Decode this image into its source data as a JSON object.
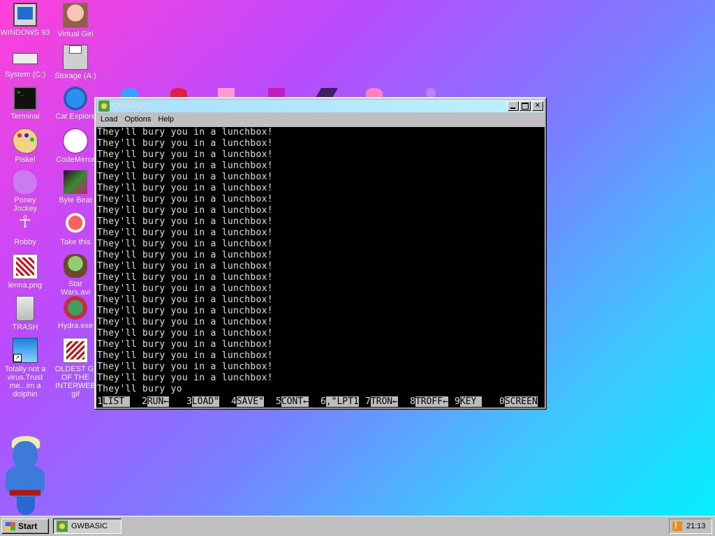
{
  "desktop": {
    "icons": [
      {
        "label": "WINDOWS 93"
      },
      {
        "label": "Virtual Girl"
      },
      {
        "label": "System (C:)"
      },
      {
        "label": "Storage (A:)"
      },
      {
        "label": "Terminal"
      },
      {
        "label": "Cat Explore"
      },
      {
        "label": "Piskel"
      },
      {
        "label": "CodeMirror"
      },
      {
        "label": "Poney\nJockey"
      },
      {
        "label": "Byte Beat"
      },
      {
        "label": "Robby"
      },
      {
        "label": "Take this"
      },
      {
        "label": "lenna.png"
      },
      {
        "label": "Star\nWars.avi"
      },
      {
        "label": "TRASH"
      },
      {
        "label": "Hydra.exe"
      },
      {
        "label": "Totally not a\nvirus.Trust\nme...im a\ndolphin"
      },
      {
        "label": "OLDEST GI\nOF THE\nINTERWEB\ngif"
      }
    ]
  },
  "window": {
    "title": "GWBASIC",
    "menu": [
      "Load",
      "Options",
      "Help"
    ],
    "console": {
      "lines": [
        "They'll bury you in a lunchbox!",
        "They'll bury you in a lunchbox!",
        "They'll bury you in a lunchbox!",
        "They'll bury you in a lunchbox!",
        "They'll bury you in a lunchbox!",
        "They'll bury you in a lunchbox!",
        "They'll bury you in a lunchbox!",
        "They'll bury you in a lunchbox!",
        "They'll bury you in a lunchbox!",
        "They'll bury you in a lunchbox!",
        "They'll bury you in a lunchbox!",
        "They'll bury you in a lunchbox!",
        "They'll bury you in a lunchbox!",
        "They'll bury you in a lunchbox!",
        "They'll bury you in a lunchbox!",
        "They'll bury you in a lunchbox!",
        "They'll bury you in a lunchbox!",
        "They'll bury you in a lunchbox!",
        "They'll bury you in a lunchbox!",
        "They'll bury you in a lunchbox!",
        "They'll bury you in a lunchbox!",
        "They'll bury you in a lunchbox!",
        "They'll bury you in a lunchbox!",
        "They'll bury yo"
      ],
      "function_keys": [
        {
          "num": "1",
          "label": "LIST "
        },
        {
          "num": "2",
          "label": "RUN←"
        },
        {
          "num": "3",
          "label": "LOAD\""
        },
        {
          "num": "4",
          "label": "SAVE\""
        },
        {
          "num": "5",
          "label": "CONT←"
        },
        {
          "num": "6",
          "label": ",\"LPT1"
        },
        {
          "num": "7",
          "label": "TRON←"
        },
        {
          "num": "8",
          "label": "TROFF←"
        },
        {
          "num": "9",
          "label": "KEY "
        },
        {
          "num": "0",
          "label": "SCREEN"
        }
      ]
    }
  },
  "taskbar": {
    "start_label": "Start",
    "task_label": "GWBASIC",
    "clock": "21:13"
  }
}
